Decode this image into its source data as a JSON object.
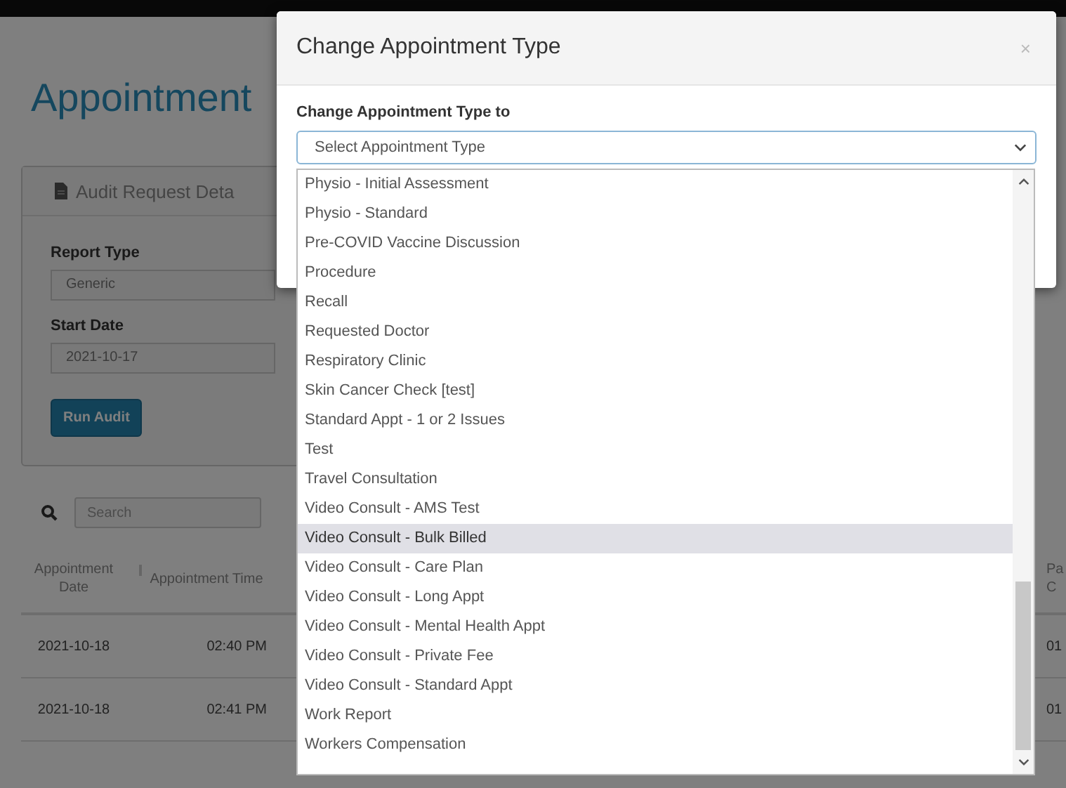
{
  "page": {
    "heading": "Appointment",
    "panel": {
      "title": "Audit Request Deta",
      "fields": [
        {
          "label": "Report Type",
          "value": "Generic"
        },
        {
          "label": "Start Date",
          "value": "2021-10-17"
        }
      ],
      "button": "Run Audit"
    },
    "search": {
      "placeholder": "Search"
    },
    "table": {
      "columns": [
        "Appointment Date",
        "Appointment Time",
        "Pa C"
      ],
      "rows": [
        [
          "2021-10-18",
          "02:40 PM",
          "01"
        ],
        [
          "2021-10-18",
          "02:41 PM",
          "01"
        ]
      ]
    }
  },
  "modal": {
    "title": "Change Appointment Type",
    "close": "×",
    "label": "Change Appointment Type to",
    "select": {
      "placeholder": "Select Appointment Type"
    },
    "options": [
      {
        "label": "Physio - Initial Assessment",
        "selected": false
      },
      {
        "label": "Physio - Standard",
        "selected": false
      },
      {
        "label": "Pre-COVID Vaccine Discussion",
        "selected": false
      },
      {
        "label": "Procedure",
        "selected": false
      },
      {
        "label": "Recall",
        "selected": false
      },
      {
        "label": "Requested Doctor",
        "selected": false
      },
      {
        "label": "Respiratory Clinic",
        "selected": false
      },
      {
        "label": "Skin Cancer Check [test]",
        "selected": false
      },
      {
        "label": "Standard Appt - 1 or 2 Issues",
        "selected": false
      },
      {
        "label": "Test",
        "selected": false
      },
      {
        "label": "Travel Consultation",
        "selected": false
      },
      {
        "label": "Video Consult - AMS Test",
        "selected": false
      },
      {
        "label": "Video Consult - Bulk Billed",
        "selected": true
      },
      {
        "label": "Video Consult - Care Plan",
        "selected": false
      },
      {
        "label": "Video Consult - Long Appt",
        "selected": false
      },
      {
        "label": "Video Consult - Mental Health Appt",
        "selected": false
      },
      {
        "label": "Video Consult - Private Fee",
        "selected": false
      },
      {
        "label": "Video Consult - Standard Appt",
        "selected": false
      },
      {
        "label": "Work Report",
        "selected": false
      },
      {
        "label": "Workers Compensation",
        "selected": false
      }
    ]
  }
}
